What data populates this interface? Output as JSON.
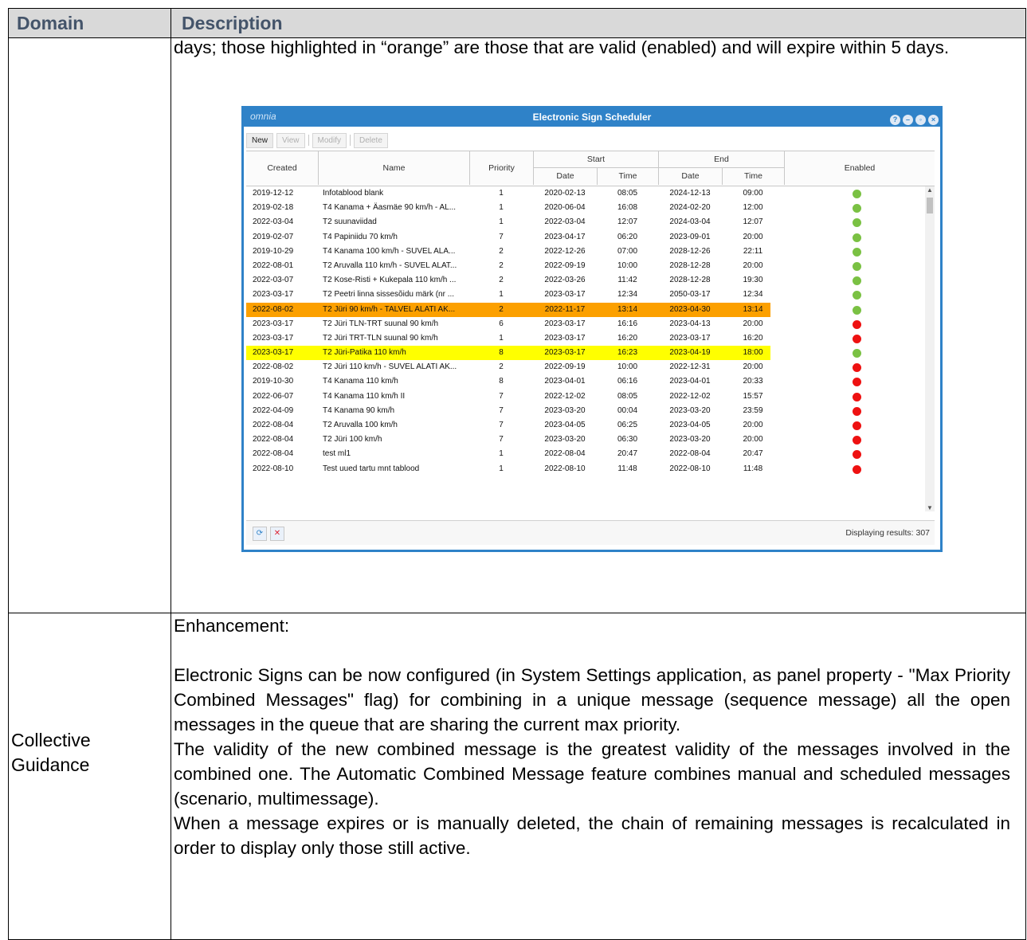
{
  "header": {
    "domain": "Domain",
    "description": "Description"
  },
  "intro": "days; those highlighted in “orange” are those that are valid (enabled) and will expire within 5 days.",
  "window": {
    "brand": "omnia",
    "title": "Electronic Sign Scheduler",
    "toolbar": {
      "new": "New",
      "view": "View",
      "modify": "Modify",
      "delete": "Delete"
    },
    "columns": {
      "created": "Created",
      "name": "Name",
      "priority": "Priority",
      "start": "Start",
      "end": "End",
      "date": "Date",
      "time": "Time",
      "enabled": "Enabled"
    },
    "rows": [
      {
        "created": "2019-12-12",
        "name": "Infotablood blank",
        "priority": "1",
        "sdate": "2020-02-13",
        "stime": "08:05",
        "edate": "2024-12-13",
        "etime": "09:00",
        "enabled": "green",
        "hl": ""
      },
      {
        "created": "2019-02-18",
        "name": "T4 Kanama + Äasmäe 90 km/h - AL...",
        "priority": "1",
        "sdate": "2020-06-04",
        "stime": "16:08",
        "edate": "2024-02-20",
        "etime": "12:00",
        "enabled": "green",
        "hl": ""
      },
      {
        "created": "2022-03-04",
        "name": "T2 suunaviidad",
        "priority": "1",
        "sdate": "2022-03-04",
        "stime": "12:07",
        "edate": "2024-03-04",
        "etime": "12:07",
        "enabled": "green",
        "hl": ""
      },
      {
        "created": "2019-02-07",
        "name": "T4 Papiniidu 70 km/h",
        "priority": "7",
        "sdate": "2023-04-17",
        "stime": "06:20",
        "edate": "2023-09-01",
        "etime": "20:00",
        "enabled": "green",
        "hl": ""
      },
      {
        "created": "2019-10-29",
        "name": "T4 Kanama 100 km/h - SUVEL ALA...",
        "priority": "2",
        "sdate": "2022-12-26",
        "stime": "07:00",
        "edate": "2028-12-26",
        "etime": "22:11",
        "enabled": "green",
        "hl": ""
      },
      {
        "created": "2022-08-01",
        "name": "T2 Aruvalla 110 km/h - SUVEL ALAT...",
        "priority": "2",
        "sdate": "2022-09-19",
        "stime": "10:00",
        "edate": "2028-12-28",
        "etime": "20:00",
        "enabled": "green",
        "hl": ""
      },
      {
        "created": "2022-03-07",
        "name": "T2 Kose-Risti + Kukepala 110 km/h ...",
        "priority": "2",
        "sdate": "2022-03-26",
        "stime": "11:42",
        "edate": "2028-12-28",
        "etime": "19:30",
        "enabled": "green",
        "hl": ""
      },
      {
        "created": "2023-03-17",
        "name": "T2 Peetri linna sissesõidu märk (nr ...",
        "priority": "1",
        "sdate": "2023-03-17",
        "stime": "12:34",
        "edate": "2050-03-17",
        "etime": "12:34",
        "enabled": "green",
        "hl": ""
      },
      {
        "created": "2022-08-02",
        "name": "T2 Jüri 90 km/h - TALVEL ALATI AK...",
        "priority": "2",
        "sdate": "2022-11-17",
        "stime": "13:14",
        "edate": "2023-04-30",
        "etime": "13:14",
        "enabled": "green",
        "hl": "orange"
      },
      {
        "created": "2023-03-17",
        "name": "T2 Jüri TLN-TRT suunal 90 km/h",
        "priority": "6",
        "sdate": "2023-03-17",
        "stime": "16:16",
        "edate": "2023-04-13",
        "etime": "20:00",
        "enabled": "red",
        "hl": ""
      },
      {
        "created": "2023-03-17",
        "name": "T2 Jüri TRT-TLN suunal 90 km/h",
        "priority": "1",
        "sdate": "2023-03-17",
        "stime": "16:20",
        "edate": "2023-03-17",
        "etime": "16:20",
        "enabled": "red",
        "hl": ""
      },
      {
        "created": "2023-03-17",
        "name": "T2 Jüri-Patika 110 km/h",
        "priority": "8",
        "sdate": "2023-03-17",
        "stime": "16:23",
        "edate": "2023-04-19",
        "etime": "18:00",
        "enabled": "green",
        "hl": "yellow"
      },
      {
        "created": "2022-08-02",
        "name": "T2 Jüri 110 km/h - SUVEL ALATI AK...",
        "priority": "2",
        "sdate": "2022-09-19",
        "stime": "10:00",
        "edate": "2022-12-31",
        "etime": "20:00",
        "enabled": "red",
        "hl": ""
      },
      {
        "created": "2019-10-30",
        "name": "T4 Kanama 110 km/h",
        "priority": "8",
        "sdate": "2023-04-01",
        "stime": "06:16",
        "edate": "2023-04-01",
        "etime": "20:33",
        "enabled": "red",
        "hl": ""
      },
      {
        "created": "2022-06-07",
        "name": "T4 Kanama 110 km/h II",
        "priority": "7",
        "sdate": "2022-12-02",
        "stime": "08:05",
        "edate": "2022-12-02",
        "etime": "15:57",
        "enabled": "red",
        "hl": ""
      },
      {
        "created": "2022-04-09",
        "name": "T4 Kanama 90 km/h",
        "priority": "7",
        "sdate": "2023-03-20",
        "stime": "00:04",
        "edate": "2023-03-20",
        "etime": "23:59",
        "enabled": "red",
        "hl": ""
      },
      {
        "created": "2022-08-04",
        "name": "T2 Aruvalla 100 km/h",
        "priority": "7",
        "sdate": "2023-04-05",
        "stime": "06:25",
        "edate": "2023-04-05",
        "etime": "20:00",
        "enabled": "red",
        "hl": ""
      },
      {
        "created": "2022-08-04",
        "name": "T2 Jüri 100 km/h",
        "priority": "7",
        "sdate": "2023-03-20",
        "stime": "06:30",
        "edate": "2023-03-20",
        "etime": "20:00",
        "enabled": "red",
        "hl": ""
      },
      {
        "created": "2022-08-04",
        "name": "test ml1",
        "priority": "1",
        "sdate": "2022-08-04",
        "stime": "20:47",
        "edate": "2022-08-04",
        "etime": "20:47",
        "enabled": "red",
        "hl": ""
      },
      {
        "created": "2022-08-10",
        "name": "Test uued tartu mnt tablood",
        "priority": "1",
        "sdate": "2022-08-10",
        "stime": "11:48",
        "edate": "2022-08-10",
        "etime": "11:48",
        "enabled": "red",
        "hl": ""
      }
    ],
    "footer": {
      "results": "Displaying results: 307"
    },
    "colors": {
      "green": "#7ac143",
      "red": "#ee1111",
      "titlebar": "#2f82c8"
    }
  },
  "collective": {
    "label_line1": "Collective",
    "label_line2": "Guidance",
    "p1": "Enhancement:",
    "p2": "Electronic Signs can be now configured (in System Settings application, as panel property - \"Max Priority Combined Messages\" flag) for combining in a unique message (sequence message) all the open messages in the queue that are sharing the current max priority.",
    "p3": "The validity of the new combined message is the greatest validity of the messages involved in the combined one. The Automatic Combined Message feature combines manual and scheduled messages (scenario, multimessage).",
    "p4": "When a message expires or is manually deleted, the chain of remaining messages is recalculated in order to display only those still active."
  }
}
